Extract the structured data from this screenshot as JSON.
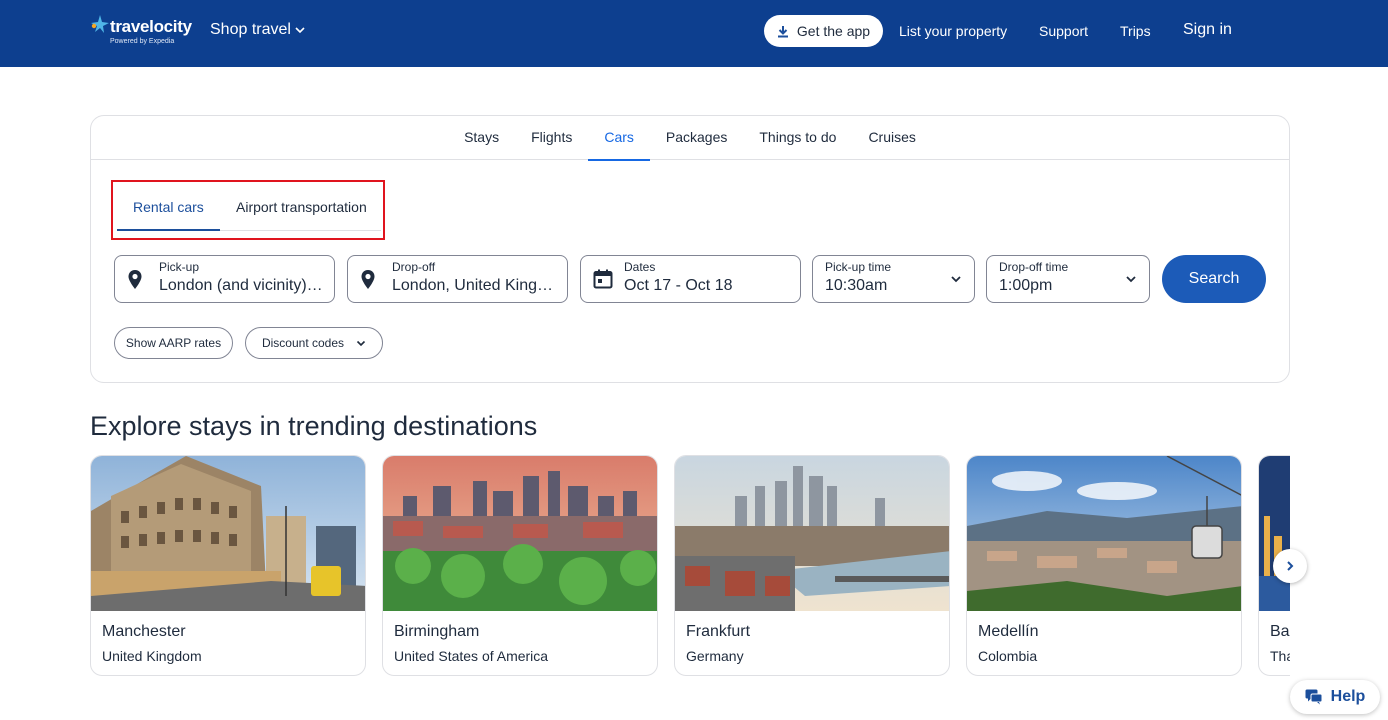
{
  "header": {
    "logo_text": "travelocity",
    "logo_powered": "Powered by Expedia",
    "shop_travel": "Shop travel",
    "get_app": "Get the app",
    "list_property": "List your property",
    "support": "Support",
    "trips": "Trips",
    "sign_in": "Sign in"
  },
  "tabs": [
    "Stays",
    "Flights",
    "Cars",
    "Packages",
    "Things to do",
    "Cruises"
  ],
  "active_tab": "Cars",
  "subtabs": {
    "rental_cars": "Rental cars",
    "airport_transportation": "Airport transportation"
  },
  "fields": {
    "pickup": {
      "label": "Pick-up",
      "value": "London (and vicinity), England, United Kingdom"
    },
    "dropoff": {
      "label": "Drop-off",
      "value": "London, United Kingdom"
    },
    "dates": {
      "label": "Dates",
      "value": "Oct 17 - Oct 18"
    },
    "pickup_time": {
      "label": "Pick-up time",
      "value": "10:30am"
    },
    "dropoff_time": {
      "label": "Drop-off time",
      "value": "1:00pm"
    }
  },
  "search_button": "Search",
  "pills": {
    "aarp": "Show AARP rates",
    "discount": "Discount codes"
  },
  "explore": {
    "title": "Explore stays in trending destinations",
    "destinations": [
      {
        "city": "Manchester",
        "country": "United Kingdom"
      },
      {
        "city": "Birmingham",
        "country": "United States of America"
      },
      {
        "city": "Frankfurt",
        "country": "Germany"
      },
      {
        "city": "Medellín",
        "country": "Colombia"
      },
      {
        "city": "Ba",
        "country": "Tha"
      }
    ]
  },
  "help": "Help",
  "colors": {
    "header_bg": "#0d3f8f",
    "accent": "#1668e3",
    "search_button": "#1c5bb8",
    "highlight_box": "#e0141e"
  }
}
